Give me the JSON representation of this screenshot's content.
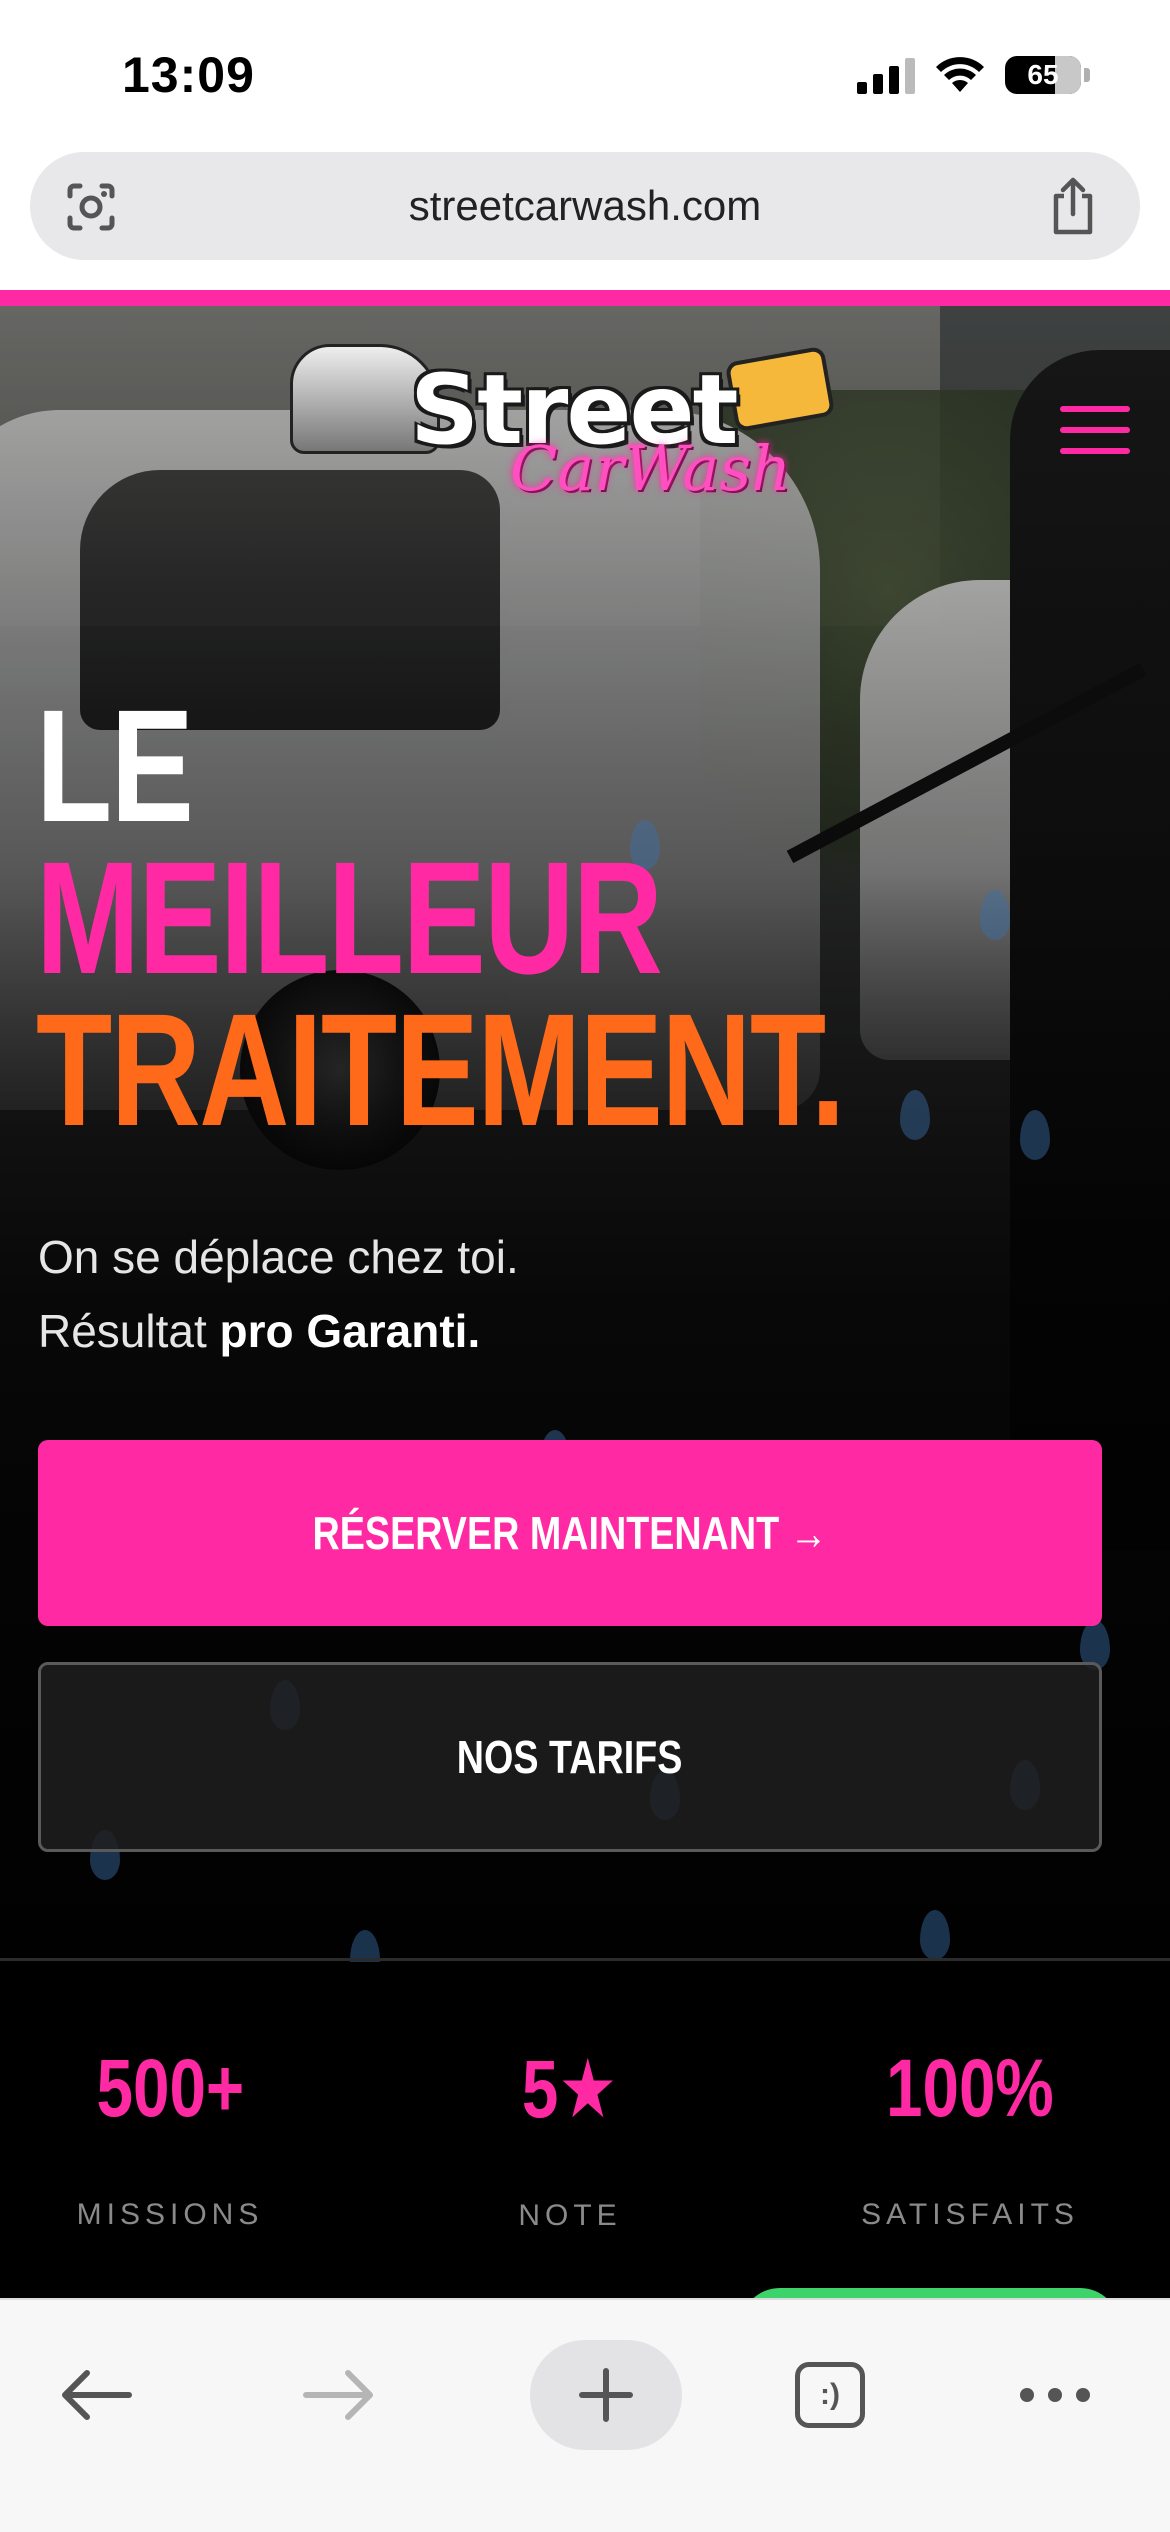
{
  "status_bar": {
    "time": "13:09",
    "battery": "65",
    "icons": [
      "signal-icon",
      "wifi-icon",
      "battery-icon"
    ]
  },
  "browser": {
    "url": "streetcarwash.com",
    "icons": [
      "lens-icon",
      "share-icon"
    ]
  },
  "site": {
    "logo": {
      "main": "Street",
      "sub": "CarWash"
    },
    "colors": {
      "accent_pink": "#ff2aa3",
      "accent_orange": "#ff6a1a",
      "background": "#0b0b0b"
    },
    "hero": {
      "line1": "LE",
      "line2": "MEILLEUR",
      "line3": "TRAITEMENT.",
      "sub_line1": "On se déplace chez toi.",
      "sub_line2_prefix": "Résultat ",
      "sub_line2_bold": "pro Garanti."
    },
    "buttons": {
      "primary": "RÉSERVER MAINTENANT →",
      "secondary": "NOS TARIFS"
    },
    "stats": [
      {
        "value": "500+",
        "label": "MISSIONS"
      },
      {
        "value": "5★",
        "label": "NOTE"
      },
      {
        "value": "100%",
        "label": "SATISFAITS"
      }
    ]
  },
  "toolbar": {
    "tabs_label": ":)",
    "icons": [
      "back-arrow-icon",
      "forward-arrow-icon",
      "plus-icon",
      "tabs-icon",
      "more-icon"
    ]
  }
}
